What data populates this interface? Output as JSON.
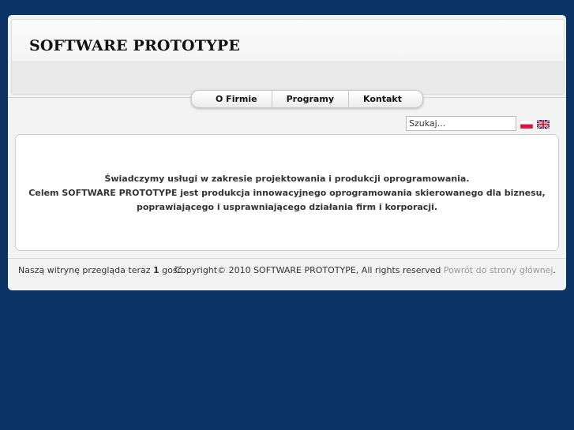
{
  "header": {
    "logo": "SOFTWARE PROTOTYPE"
  },
  "nav": {
    "items": [
      "O Firmie",
      "Programy",
      "Kontakt"
    ]
  },
  "search": {
    "value": "Szukaj..."
  },
  "languages": [
    "polish-flag-icon",
    "english-flag-icon"
  ],
  "content": {
    "line1": "Świadczymy usługi w zakresie projektowania i produkcji oprogramowania.",
    "line2": "Celem SOFTWARE PROTOTYPE jest produkcja innowacyjnego oprogramowania skierowanego dla biznesu,",
    "line3": "poprawiającego i usprawniającego działania firm i korporacji."
  },
  "footer": {
    "visitors_prefix": "Naszą witrynę przegląda teraz",
    "visitors_count": "1",
    "visitors_suffix": "gość",
    "copyright": "Copyright© 2010 SOFTWARE PROTOTYPE, All rights reserved",
    "home_link": "Powrót do strony głównej",
    "home_link_suffix": "."
  },
  "colors": {
    "background": "#0b3465",
    "panel": "#f3f3f3",
    "link": "#999999"
  }
}
